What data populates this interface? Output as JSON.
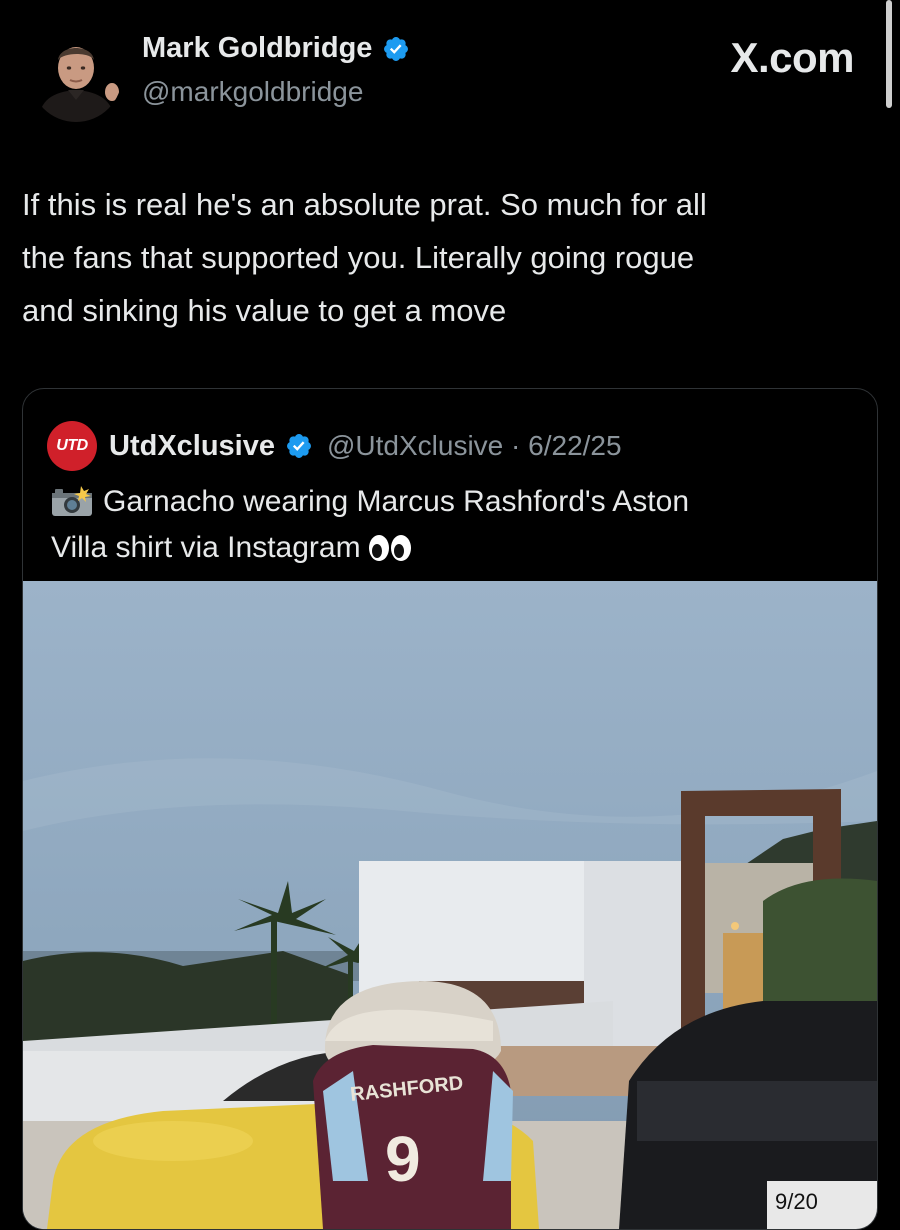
{
  "author": {
    "display_name": "Mark Goldbridge",
    "handle": "@markgoldbridge",
    "verified": true
  },
  "brand": "X.com",
  "tweet": {
    "text_lines": [
      "If this is real he's an absolute prat. So much for all",
      "the fans that supported you. Literally going rogue",
      "and sinking his value to get a move"
    ]
  },
  "quoted_tweet": {
    "logo_text": "UTD",
    "display_name": "UtdXclusive",
    "verified": true,
    "handle_date": "@UtdXclusive · 6/22/25",
    "text_line1": "Garnacho wearing Marcus Rashford's Aston",
    "text_line2": "Villa shirt via Instagram",
    "leading_icon": "camera-flash-icon",
    "trailing_icon": "eyes-icon",
    "photo": {
      "shirt_name": "RASHFORD",
      "shirt_number": "9",
      "plate_text": "9/20"
    }
  },
  "colors": {
    "background": "#000000",
    "text": "#e7e9ea",
    "muted": "#8b949b",
    "verified": "#1d9bf0",
    "border": "#2f3336"
  }
}
